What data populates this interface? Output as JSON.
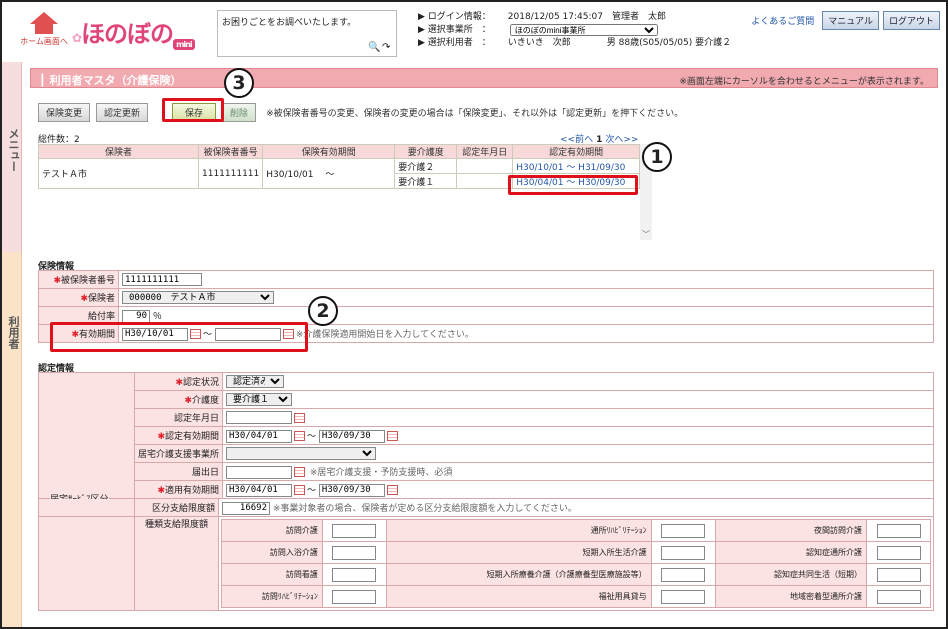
{
  "header": {
    "home_label": "ホーム画面へ",
    "logo_text": "ほのぼの",
    "logo_sub": "mini",
    "help_text": "お困りごとをお調べいたします。",
    "login_label": "ログイン情報：",
    "login_value": "2018/12/05 17:45:07　管理者　太郎",
    "office_label": "選択事業所　：",
    "office_value": "ほのぼのmini事業所",
    "user_label": "選択利用者　：",
    "user_value": "いきいき　次郎　　　　男 88歳(S05/05/05) 要介護２",
    "faq": "よくあるご質問",
    "manual": "マニュアル",
    "logout": "ログアウト"
  },
  "sidebar": {
    "menu": "メニュー",
    "user": "利用者"
  },
  "page": {
    "title": "利用者マスタ（介護保険）",
    "title_note": "※画面左端にカーソルを合わせるとメニューが表示されます。",
    "buttons": {
      "change": "保険変更",
      "renew": "認定更新",
      "save": "保存",
      "delete": "削除"
    },
    "button_note": "※被保険者番号の変更、保険者の変更の場合は「保険変更」、それ以外は「認定更新」を押下ください。",
    "total": "総件数：2",
    "pager": {
      "prev": "<<前へ",
      "page": "1",
      "next": "次へ>>"
    }
  },
  "insurance_table": {
    "headers": [
      "保険者",
      "被保険者番号",
      "保険有効期間",
      "要介護度",
      "認定年月日",
      "認定有効期間"
    ],
    "insurer": "テストＡ市",
    "number": "1111111111",
    "period": "H30/10/01　 〜",
    "rows": [
      {
        "level": "要介護２",
        "date": "",
        "validity": "H30/10/01 〜 H31/09/30"
      },
      {
        "level": "要介護１",
        "date": "",
        "validity": "H30/04/01 〜 H30/09/30"
      }
    ]
  },
  "insurance_info": {
    "section": "保険情報",
    "number_label": "被保険者番号",
    "number_value": "1111111111",
    "insurer_label": "保険者",
    "insurer_value": "000000　テストＡ市",
    "rate_label": "給付率",
    "rate_value": "90",
    "rate_unit": "％",
    "period_label": "有効期間",
    "period_from": "H30/10/01",
    "period_to": "",
    "tilde": "〜",
    "period_hint": "※介護保険適用開始日を入力してください。"
  },
  "certification": {
    "section": "認定情報",
    "status_label": "認定状況",
    "status_value": "認定済み",
    "level_label": "介護度",
    "level_value": "要介護１",
    "date_label": "認定年月日",
    "validity_label": "認定有効期間",
    "validity_from": "H30/04/01",
    "validity_to": "H30/09/30",
    "support_label": "居宅介護支援事業所",
    "notify_label": "届出日",
    "notify_hint": "※居宅介護支援・予防支援時、必須",
    "service_group": "居宅ｻｰﾋﾞｽ区分",
    "apply_label": "適用有効期間",
    "apply_from": "H30/04/01",
    "apply_to": "H30/09/30",
    "limit_label": "区分支給限度額",
    "limit_value": "16692",
    "limit_hint": "※事業対象者の場合、保険者が定める区分支給限度額を入力してください。",
    "kind_label": "種類支給限度額",
    "services": [
      [
        "訪問介護",
        "通所ﾘﾊﾋﾞﾘﾃｰｼｮﾝ",
        "夜間訪問介護"
      ],
      [
        "訪問入浴介護",
        "短期入所生活介護",
        "認知症通所介護"
      ],
      [
        "訪問看護",
        "短期入所療養介護（介護療養型医療施設等）",
        "認知症共同生活（短期）"
      ],
      [
        "訪問ﾘﾊﾋﾞﾘﾃｰｼｮﾝ",
        "福祉用具貸与",
        "地域密着型通所介護"
      ]
    ]
  },
  "callouts": [
    "1",
    "2",
    "3"
  ]
}
